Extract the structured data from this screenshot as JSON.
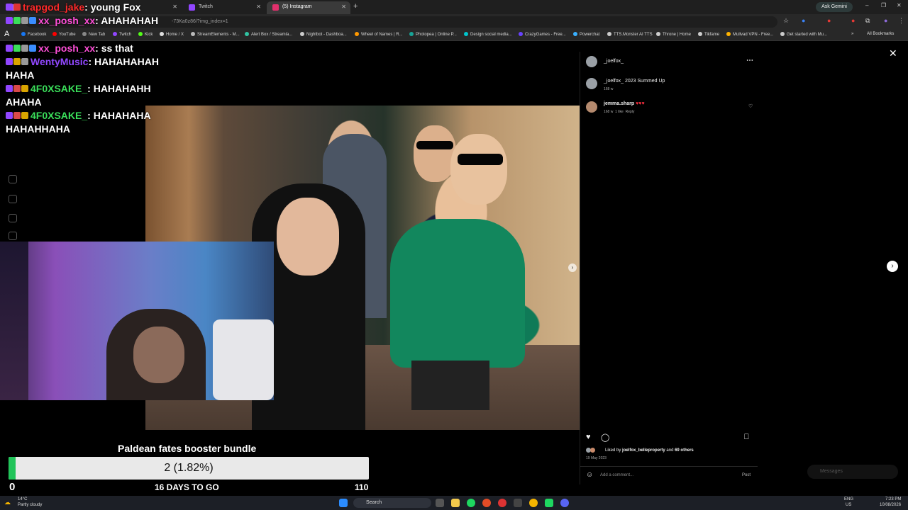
{
  "browser": {
    "tabs": [
      {
        "label": "",
        "color": "#a970ff"
      },
      {
        "label": "Twitch",
        "color": "#9146ff"
      },
      {
        "label": "(5) Instagram",
        "color": "#e1306c"
      }
    ],
    "ask_gemini": "Ask Gemini",
    "url": "-73Ka0z86/?img_index=1",
    "bookmarks": [
      "Facebook",
      "YouTube",
      "New Tab",
      "Twitch",
      "Kick",
      "Home / X",
      "StreamElements - M...",
      "Alert Box / Streamla...",
      "Nightbot - Dashboa...",
      "Wheel of Names | R...",
      "Photopea | Online P...",
      "Design social media...",
      "CrazyGames - Free...",
      "Powerchat",
      "TTS.Monster AI TTS",
      "Throne | Home",
      "Tikfame",
      "Mullvad VPN - Free...",
      "Get started with Mu..."
    ],
    "all_bookmarks": "All Bookmarks"
  },
  "chat": [
    {
      "user": "trapgod_jake",
      "user_color": "#ff2a2a",
      "message": ": young Fox"
    },
    {
      "user": "xx_posh_xx",
      "user_color": "#ff4fd8",
      "message": ": AHAHAHAH"
    },
    {
      "user": "xx_posh_xx",
      "user_color": "#ff4fd8",
      "message": ": ss that"
    },
    {
      "user": "WentyMusic",
      "user_color": "#9147ff",
      "message": ": HAHAHAHAH"
    },
    {
      "user": "",
      "user_color": "#ffffff",
      "message": "HAHA"
    },
    {
      "user": "4F0XSAKE_",
      "user_color": "#3adf5a",
      "message": ": HAHAHAHH"
    },
    {
      "user": "",
      "user_color": "#ffffff",
      "message": "AHAHA"
    },
    {
      "user": "4F0XSAKE_",
      "user_color": "#3adf5a",
      "message": ": HAHAHAHA"
    },
    {
      "user": "",
      "user_color": "#ffffff",
      "message": "HAHAHHAHA"
    }
  ],
  "instagram": {
    "author": "_joelfox_",
    "caption_user": "_joelfox_",
    "caption_text": "2023 Summed Up",
    "caption_time": "168 w",
    "comment_user": "jemma.sharp",
    "comment_text": "♥♥♥",
    "comment_time": "168 w",
    "comment_likes": "1 like",
    "comment_reply": "Reply",
    "liked_by_prefix": "Liked by",
    "liked_by_user": "joelfox_belleproperty",
    "liked_by_suffix": "and",
    "liked_by_others": "69 others",
    "date": "19 May 2023",
    "comment_placeholder": "Add a comment...",
    "post_button": "Post",
    "messages": "Messages"
  },
  "goal": {
    "title": "Paldean fates booster bundle",
    "progress_text": "2 (1.82%)",
    "progress_fraction": 0.0182,
    "min": "0",
    "max": "110",
    "days_left": "16 DAYS TO GO",
    "fill_color": "#22c45a"
  },
  "taskbar": {
    "temperature": "14°C",
    "weather": "Partly cloudy",
    "search": "Search",
    "lang": "ENG",
    "region": "US",
    "time": "7:23 PM",
    "date": "10/08/2026"
  }
}
